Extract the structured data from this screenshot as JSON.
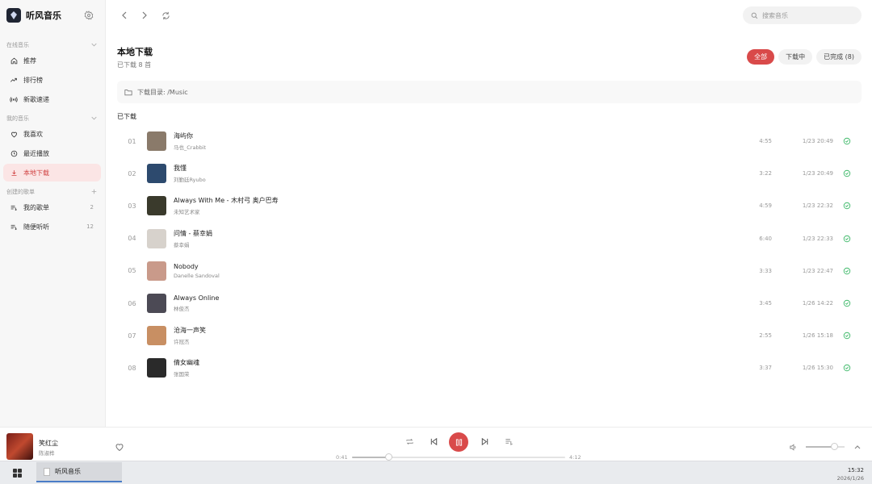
{
  "app": {
    "name": "听风音乐"
  },
  "sidebar": {
    "sections": [
      {
        "label": "在线音乐",
        "items": [
          {
            "label": "推荐",
            "icon": "home-icon"
          },
          {
            "label": "排行榜",
            "icon": "trend-icon"
          },
          {
            "label": "新歌速递",
            "icon": "radio-icon"
          }
        ]
      },
      {
        "label": "我的音乐",
        "items": [
          {
            "label": "我喜欢",
            "icon": "heart-icon"
          },
          {
            "label": "最近播放",
            "icon": "clock-icon"
          },
          {
            "label": "本地下载",
            "icon": "download-icon",
            "active": true
          }
        ]
      },
      {
        "label": "创建的歌单",
        "items": [
          {
            "label": "我的歌单",
            "icon": "playlist-icon",
            "count": "2"
          },
          {
            "label": "随便听听",
            "icon": "playlist-icon",
            "count": "12"
          }
        ]
      }
    ]
  },
  "search": {
    "placeholder": "搜索音乐"
  },
  "page": {
    "title": "本地下载",
    "subtitle": "已下载 8 首",
    "filters": [
      {
        "label": "全部",
        "active": true
      },
      {
        "label": "下载中",
        "active": false
      },
      {
        "label": "已完成 (8)",
        "active": false
      }
    ],
    "directory": "下载目录: /Music",
    "list_heading": "已下载"
  },
  "songs": [
    {
      "index": "01",
      "title": "海屿你",
      "artist": "马也_Crabbit",
      "duration": "4:55",
      "time": "1/23 20:49",
      "cover": "#8a7a6a"
    },
    {
      "index": "02",
      "title": "我懂",
      "artist": "刘勤廷Ryubo",
      "duration": "3:22",
      "time": "1/23 20:49",
      "cover": "#2d4a6e"
    },
    {
      "index": "03",
      "title": "Always With Me - 木村弓 奥户巴寿",
      "artist": "未知艺术家",
      "duration": "4:59",
      "time": "1/23 22:32",
      "cover": "#3a3a2c"
    },
    {
      "index": "04",
      "title": "问情 - 蔡幸娟",
      "artist": "蔡幸娟",
      "duration": "6:40",
      "time": "1/23 22:33",
      "cover": "#d7d2cc"
    },
    {
      "index": "05",
      "title": "Nobody",
      "artist": "Danelle Sandoval",
      "duration": "3:33",
      "time": "1/23 22:47",
      "cover": "#c99a8a"
    },
    {
      "index": "06",
      "title": "Always Online",
      "artist": "林俊杰",
      "duration": "3:45",
      "time": "1/26 14:22",
      "cover": "#4c4a55"
    },
    {
      "index": "07",
      "title": "沧海一声笑",
      "artist": "许冠杰",
      "duration": "2:55",
      "time": "1/26 15:18",
      "cover": "#c88f63"
    },
    {
      "index": "08",
      "title": "倩女幽魂",
      "artist": "张国荣",
      "duration": "3:37",
      "time": "1/26 15:30",
      "cover": "#2a2a2a"
    }
  ],
  "player": {
    "title": "笑红尘",
    "artist": "陈淑桦",
    "current_time": "0:41",
    "total_time": "4:12",
    "progress": 0.17,
    "volume": 0.72
  },
  "taskbar": {
    "app_label": "听风音乐",
    "time": "15:32",
    "date": "2026/1/26"
  },
  "colors": {
    "accent": "#d94a4a",
    "success": "#3fb96a"
  }
}
